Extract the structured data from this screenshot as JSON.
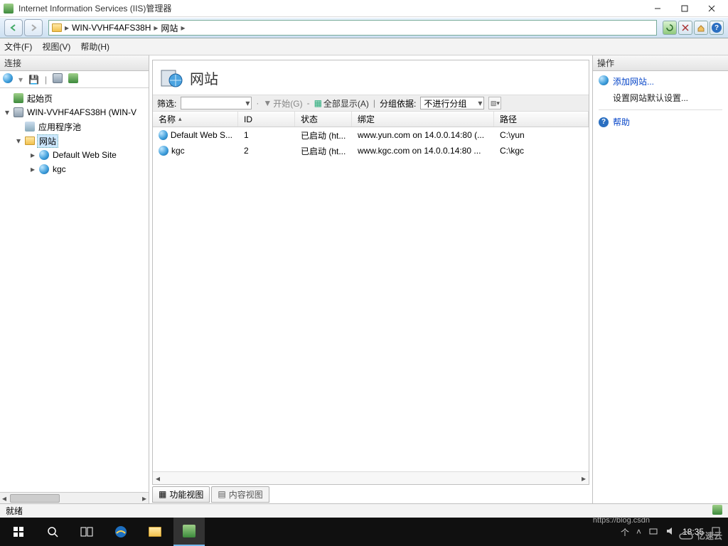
{
  "window": {
    "title": "Internet Information Services (IIS)管理器"
  },
  "breadcrumb": {
    "server": "WIN-VVHF4AFS38H",
    "node": "网站"
  },
  "menu": {
    "file": "文件(F)",
    "view": "视图(V)",
    "help": "帮助(H)"
  },
  "connections": {
    "header": "连接",
    "start_page": "起始页",
    "server": "WIN-VVHF4AFS38H (WIN-V",
    "app_pools": "应用程序池",
    "sites": "网站",
    "site_items": [
      "Default Web Site",
      "kgc"
    ]
  },
  "center": {
    "title": "网站",
    "filter_label": "筛选:",
    "start_btn": "开始(G)",
    "show_all": "全部显示(A)",
    "group_by": "分组依据:",
    "group_value": "不进行分组",
    "columns": {
      "name": "名称",
      "id": "ID",
      "status": "状态",
      "binding": "绑定",
      "path": "路径"
    },
    "rows": [
      {
        "name": "Default Web S...",
        "id": "1",
        "status": "已启动 (ht...",
        "binding": "www.yun.com on 14.0.0.14:80 (...",
        "path": "C:\\yun"
      },
      {
        "name": "kgc",
        "id": "2",
        "status": "已启动 (ht...",
        "binding": "www.kgc.com on 14.0.0.14:80 ...",
        "path": "C:\\kgc"
      }
    ],
    "views": {
      "features": "功能视图",
      "content": "内容视图"
    }
  },
  "actions": {
    "header": "操作",
    "add_site": "添加网站...",
    "set_defaults": "设置网站默认设置...",
    "help": "帮助"
  },
  "statusbar": {
    "ready": "就绪"
  },
  "taskbar": {
    "time": "18:35",
    "tray_text": "个"
  },
  "watermark": {
    "brand": "亿速云",
    "faint": "https://blog.csdn"
  }
}
